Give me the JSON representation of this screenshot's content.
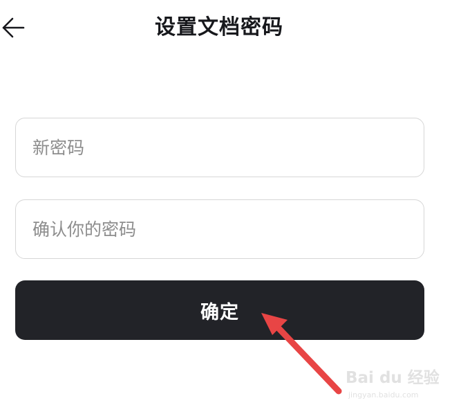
{
  "header": {
    "title": "设置文档密码",
    "back_icon": "arrow-left-icon"
  },
  "form": {
    "new_password": {
      "value": "",
      "placeholder": "新密码"
    },
    "confirm_password": {
      "value": "",
      "placeholder": "确认你的密码"
    },
    "submit_label": "确定"
  },
  "annotation": {
    "arrow_color": "#e84545"
  },
  "watermark": {
    "logo": "Bai du 经验",
    "url": "jingyan.baidu.com"
  },
  "colors": {
    "button_background": "#222328",
    "button_text": "#ffffff",
    "field_border": "#d6d6d6",
    "placeholder_text": "#8d8d8d"
  }
}
